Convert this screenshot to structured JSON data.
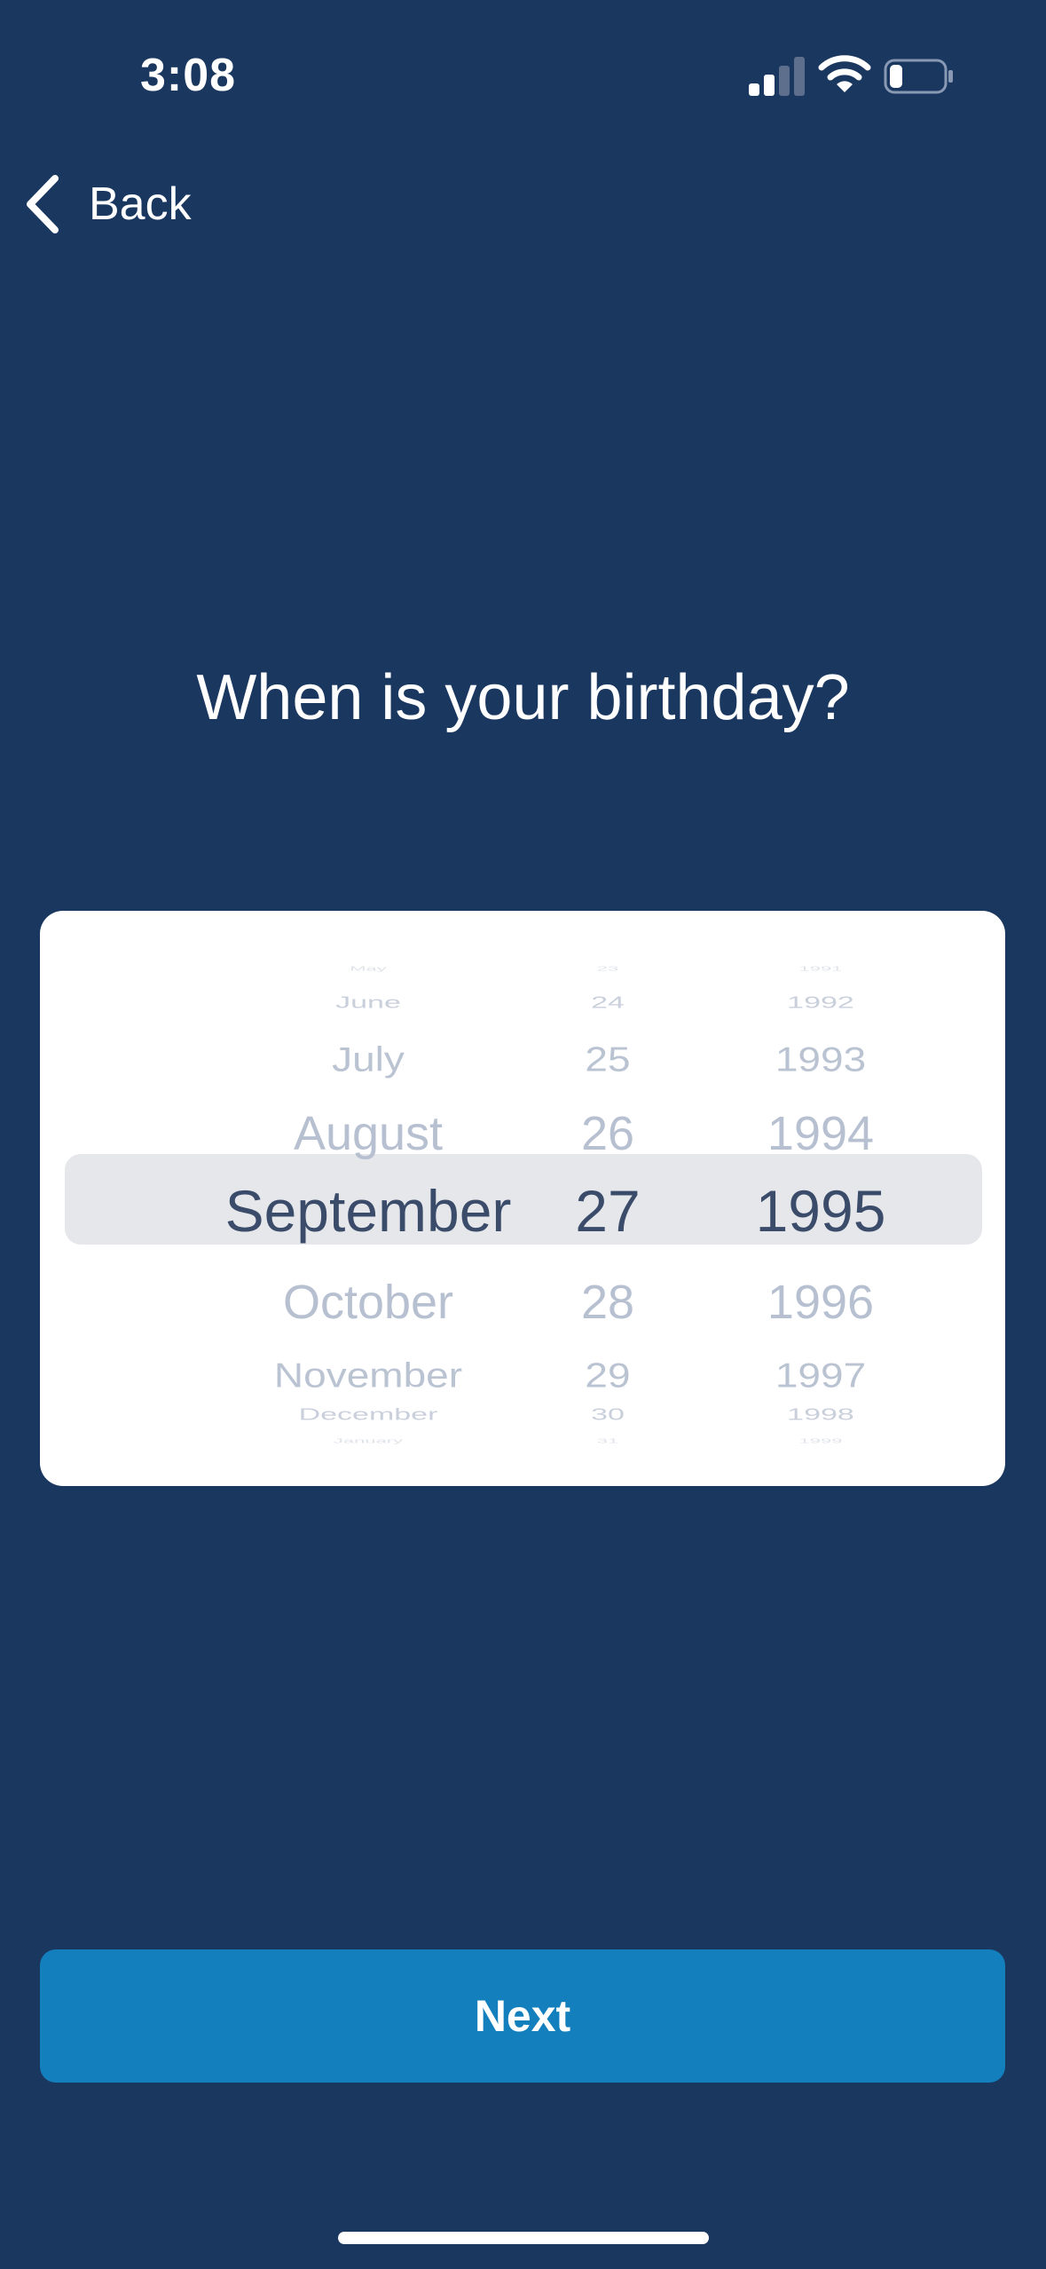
{
  "status_bar": {
    "time": "3:08",
    "signal_icon": "cellular-signal-icon",
    "wifi_icon": "wifi-icon",
    "battery_icon": "battery-low-icon"
  },
  "nav": {
    "back_label": "Back",
    "back_icon": "chevron-left-icon"
  },
  "title": "When is your birthday?",
  "picker": {
    "months": [
      "May",
      "June",
      "July",
      "August",
      "September",
      "October",
      "November",
      "December",
      "January"
    ],
    "days": [
      "23",
      "24",
      "25",
      "26",
      "27",
      "28",
      "29",
      "30",
      "31"
    ],
    "years": [
      "1991",
      "1992",
      "1993",
      "1994",
      "1995",
      "1996",
      "1997",
      "1998",
      "1999"
    ],
    "selected": {
      "month": "September",
      "day": "27",
      "year": "1995"
    }
  },
  "next_label": "Next",
  "colors": {
    "background": "#1a3760",
    "accent": "#1380bd",
    "picker_text": "#3b4c6b",
    "picker_faded": "#b7c0d0"
  }
}
